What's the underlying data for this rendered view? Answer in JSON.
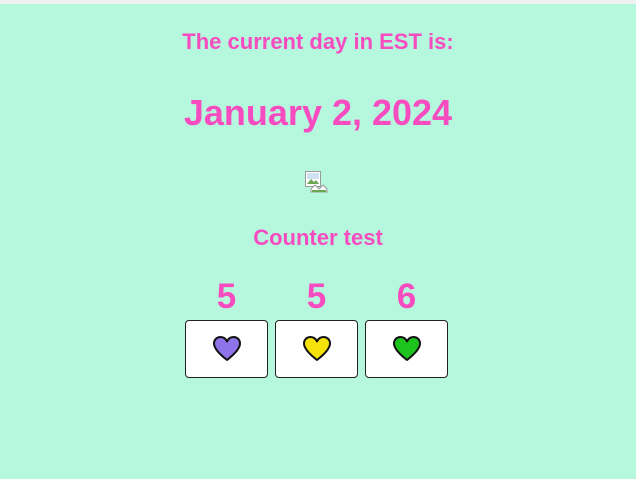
{
  "header": {
    "label": "The current day in EST is:",
    "date": "January 2, 2024"
  },
  "image": {
    "icon": "broken-image-icon"
  },
  "counter_section": {
    "title": "Counter test",
    "counters": [
      {
        "value": "5",
        "heart_color": "#8f73e8",
        "icon": "heart-icon"
      },
      {
        "value": "5",
        "heart_color": "#f5e20a",
        "icon": "heart-icon"
      },
      {
        "value": "6",
        "heart_color": "#1ec41e",
        "icon": "heart-icon"
      }
    ]
  },
  "colors": {
    "background": "#b6f8dd",
    "accent": "#f64cc0"
  }
}
